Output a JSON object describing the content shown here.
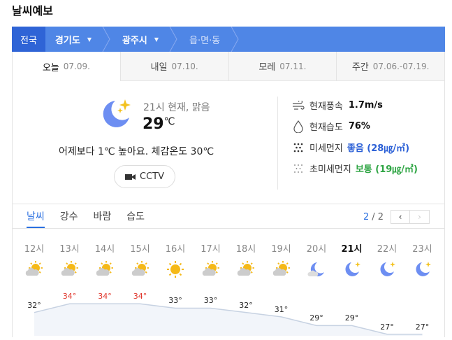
{
  "title": "날씨예보",
  "breadcrumb": [
    {
      "label": "전국"
    },
    {
      "label": "경기도"
    },
    {
      "label": "광주시"
    },
    {
      "label": "읍·면·동"
    }
  ],
  "day_tabs": [
    {
      "label": "오늘",
      "date": "07.09."
    },
    {
      "label": "내일",
      "date": "07.10."
    },
    {
      "label": "모레",
      "date": "07.11."
    },
    {
      "label": "주간",
      "date": "07.06.-07.19."
    }
  ],
  "current": {
    "status": "21시 현재, 맑음",
    "temp": "29",
    "unit": "℃",
    "compare": "어제보다 1℃ 높아요.  체감온도 30℃",
    "cctv": "CCTV"
  },
  "stats": [
    {
      "label": "현재풍속",
      "value": "1.7m/s",
      "icon": "wind-icon"
    },
    {
      "label": "현재습도",
      "value": "76%",
      "icon": "humidity-icon"
    },
    {
      "label": "미세먼지",
      "value": "좋음 (28㎍/㎥)",
      "icon": "dust-icon"
    },
    {
      "label": "초미세먼지",
      "value": "보통 (19㎍/㎥)",
      "icon": "fine-dust-icon"
    }
  ],
  "forecast_tabs": [
    "날씨",
    "강수",
    "바람",
    "습도"
  ],
  "pager": {
    "current": "2",
    "total": "/ 2",
    "prev": "‹",
    "next": "›"
  },
  "hours": [
    "12시",
    "13시",
    "14시",
    "15시",
    "16시",
    "17시",
    "18시",
    "19시",
    "20시",
    "21시",
    "22시",
    "23시"
  ],
  "hour_icons": [
    "partly-cloudy-sun",
    "partly-cloudy-sun",
    "partly-cloudy-sun",
    "partly-cloudy-sun",
    "sun",
    "partly-cloudy-sun",
    "partly-cloudy-sun",
    "partly-cloudy-sun",
    "moon-cloud",
    "moon-star",
    "moon-star",
    "moon-star"
  ],
  "temps": [
    "32°",
    "34°",
    "34°",
    "34°",
    "33°",
    "33°",
    "32°",
    "31°",
    "29°",
    "29°",
    "27°",
    "27°"
  ],
  "chart_data": {
    "type": "line",
    "x": [
      "12시",
      "13시",
      "14시",
      "15시",
      "16시",
      "17시",
      "18시",
      "19시",
      "20시",
      "21시",
      "22시",
      "23시"
    ],
    "values": [
      32,
      34,
      34,
      34,
      33,
      33,
      32,
      31,
      29,
      29,
      27,
      27
    ]
  }
}
